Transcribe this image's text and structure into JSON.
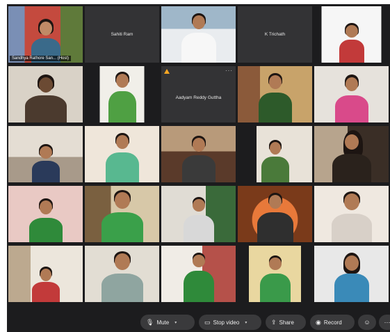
{
  "participants": {
    "host_name": "Sandhya Rathore San... (Host)",
    "p2": "Sahiti Ram",
    "p4": "K Trichath",
    "p8": "Aadyam Reddy Guttha"
  },
  "toolbar": {
    "mute_label": "Mute",
    "stop_video_label": "Stop video",
    "share_label": "Share",
    "record_label": "Record"
  },
  "colors": {
    "active_speaker_border": "#2fb0d9",
    "background": "#1c1c1e",
    "toolbar_button": "#3a3a3c"
  }
}
